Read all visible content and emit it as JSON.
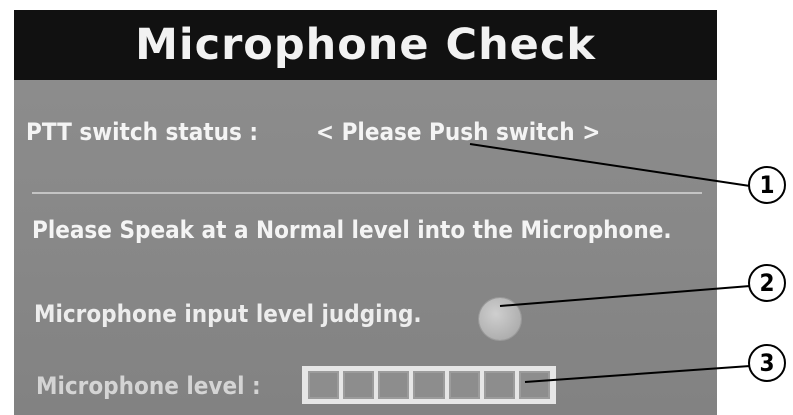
{
  "screen": {
    "title": "Microphone Check",
    "ptt_label": "PTT switch status :",
    "ptt_status": "< Please Push switch >",
    "instruction": "Please Speak at a Normal level into the Microphone.",
    "judging_label": "Microphone input level judging.",
    "mic_level_label": "Microphone level :",
    "level_meter": {
      "segments": 7,
      "lit_segments": 0
    }
  },
  "callouts": [
    "1",
    "2",
    "3"
  ],
  "colors": {
    "title_bar": "#111111",
    "screen_background": "#8a8a8a",
    "text": "#f4f4f4",
    "meter_frame": "#e6e6e6"
  }
}
